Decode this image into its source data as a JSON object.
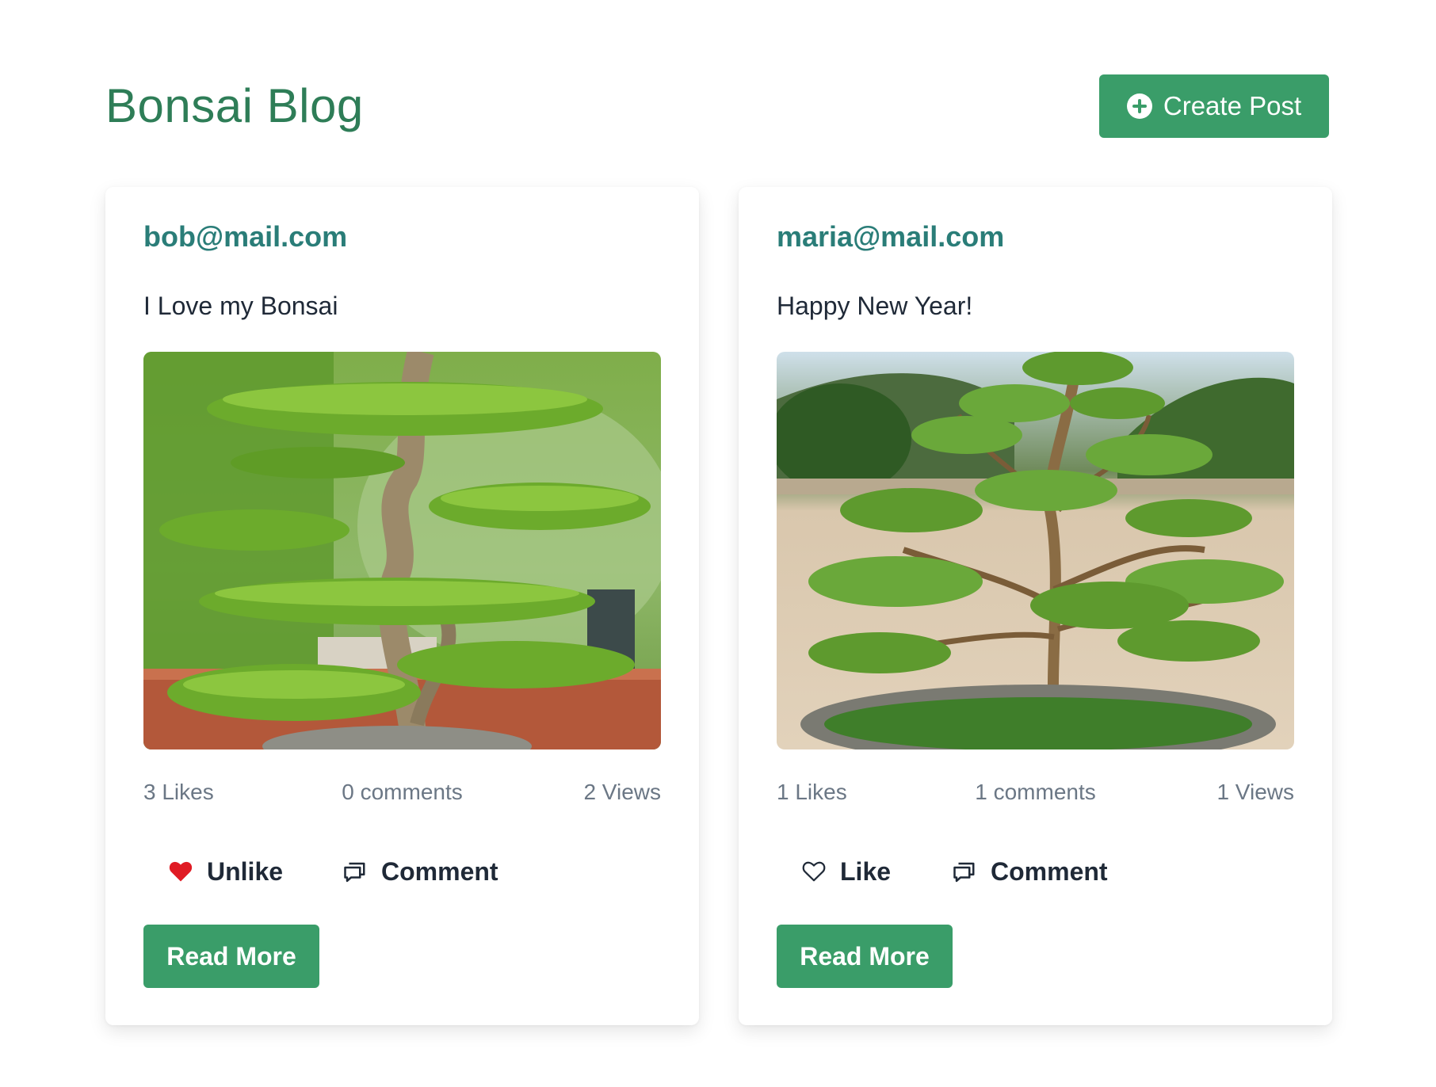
{
  "header": {
    "title": "Bonsai Blog",
    "create_button_label": "Create Post",
    "create_button_icon": "plus-circle-icon"
  },
  "colors": {
    "brand_green": "#3a9d69",
    "title_green": "#2e7d57",
    "author_teal": "#2a7d78",
    "liked_heart": "#e01b24",
    "muted_text": "#6b7785"
  },
  "posts": [
    {
      "author": "bob@mail.com",
      "title": "I Love my Bonsai",
      "image_icon": "bonsai-photo",
      "likes": "3 Likes",
      "comments": "0 comments",
      "views": "2 Views",
      "like_label": "Unlike",
      "liked": true,
      "comment_label": "Comment",
      "read_more_label": "Read More"
    },
    {
      "author": "maria@mail.com",
      "title": "Happy New Year!",
      "image_icon": "bonsai-photo",
      "likes": "1 Likes",
      "comments": "1 comments",
      "views": "1 Views",
      "like_label": "Like",
      "liked": false,
      "comment_label": "Comment",
      "read_more_label": "Read More"
    }
  ]
}
